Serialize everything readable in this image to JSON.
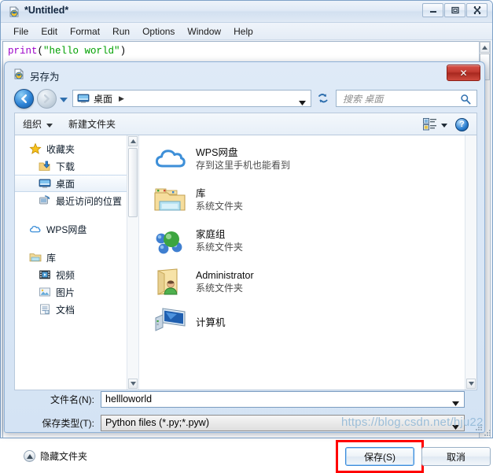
{
  "editor": {
    "title": "*Untitled*",
    "app_icon": "python-idle-icon",
    "window_controls": {
      "minimize": "minimize-icon",
      "maximize": "maximize-icon",
      "close": "close-icon"
    },
    "menu": [
      {
        "label": "File"
      },
      {
        "label": "Edit"
      },
      {
        "label": "Format"
      },
      {
        "label": "Run"
      },
      {
        "label": "Options"
      },
      {
        "label": "Window"
      },
      {
        "label": "Help"
      }
    ],
    "code": {
      "keyword": "print",
      "open_paren": "(",
      "string": "\"hello world\"",
      "close_paren": ")"
    }
  },
  "dialog": {
    "title": "另存为",
    "icon": "python-file-icon",
    "close_label": "✕",
    "nav": {
      "back_icon": "back-arrow-icon",
      "forward_icon": "forward-arrow-icon",
      "recent_icon": "chevron-down-icon",
      "address_icon": "desktop-icon",
      "address_text": "桌面",
      "address_separator": "▶",
      "refresh_icon": "refresh-icon",
      "search_placeholder": "搜索 桌面",
      "search_icon": "search-icon"
    },
    "toolbar": {
      "organize_label": "组织",
      "new_folder_label": "新建文件夹",
      "view_icon": "view-mode-icon",
      "view_caret": "▼",
      "help_label": "?"
    },
    "sidebar": [
      {
        "label": "收藏夹",
        "icon": "star-icon",
        "level": "root",
        "selected": false
      },
      {
        "label": "下载",
        "icon": "downloads-icon",
        "level": "child",
        "selected": false
      },
      {
        "label": "桌面",
        "icon": "desktop-icon",
        "level": "child",
        "selected": true
      },
      {
        "label": "最近访问的位置",
        "icon": "recent-places-icon",
        "level": "child",
        "selected": false
      },
      {
        "label": "WPS网盘",
        "icon": "wps-cloud-icon",
        "level": "root",
        "selected": false
      },
      {
        "label": "库",
        "icon": "library-icon",
        "level": "root",
        "selected": false
      },
      {
        "label": "视频",
        "icon": "video-icon",
        "level": "child",
        "selected": false
      },
      {
        "label": "图片",
        "icon": "pictures-icon",
        "level": "child",
        "selected": false
      },
      {
        "label": "文档",
        "icon": "documents-icon",
        "level": "child",
        "selected": false
      }
    ],
    "files": [
      {
        "name": "WPS网盘",
        "subtitle": "存到这里手机也能看到",
        "icon": "wps-cloud-icon"
      },
      {
        "name": "库",
        "subtitle": "系统文件夹",
        "icon": "library-folder-icon"
      },
      {
        "name": "家庭组",
        "subtitle": "系统文件夹",
        "icon": "homegroup-icon"
      },
      {
        "name": "Administrator",
        "subtitle": "系统文件夹",
        "icon": "user-folder-icon"
      },
      {
        "name": "计算机",
        "subtitle": "",
        "icon": "computer-icon"
      }
    ],
    "form": {
      "filename_label": "文件名(N):",
      "filename_value": "hellloworld",
      "filetype_label": "保存类型(T):",
      "filetype_value": "Python files (*.py;*.pyw)"
    },
    "footer": {
      "hide_folders_label": "隐藏文件夹",
      "hide_folders_icon": "chevron-up-circle-icon",
      "save_label": "保存(S)",
      "cancel_label": "取消",
      "highlight_color": "#ff0000"
    }
  },
  "watermark": "https://blog.csdn.net/hju22"
}
